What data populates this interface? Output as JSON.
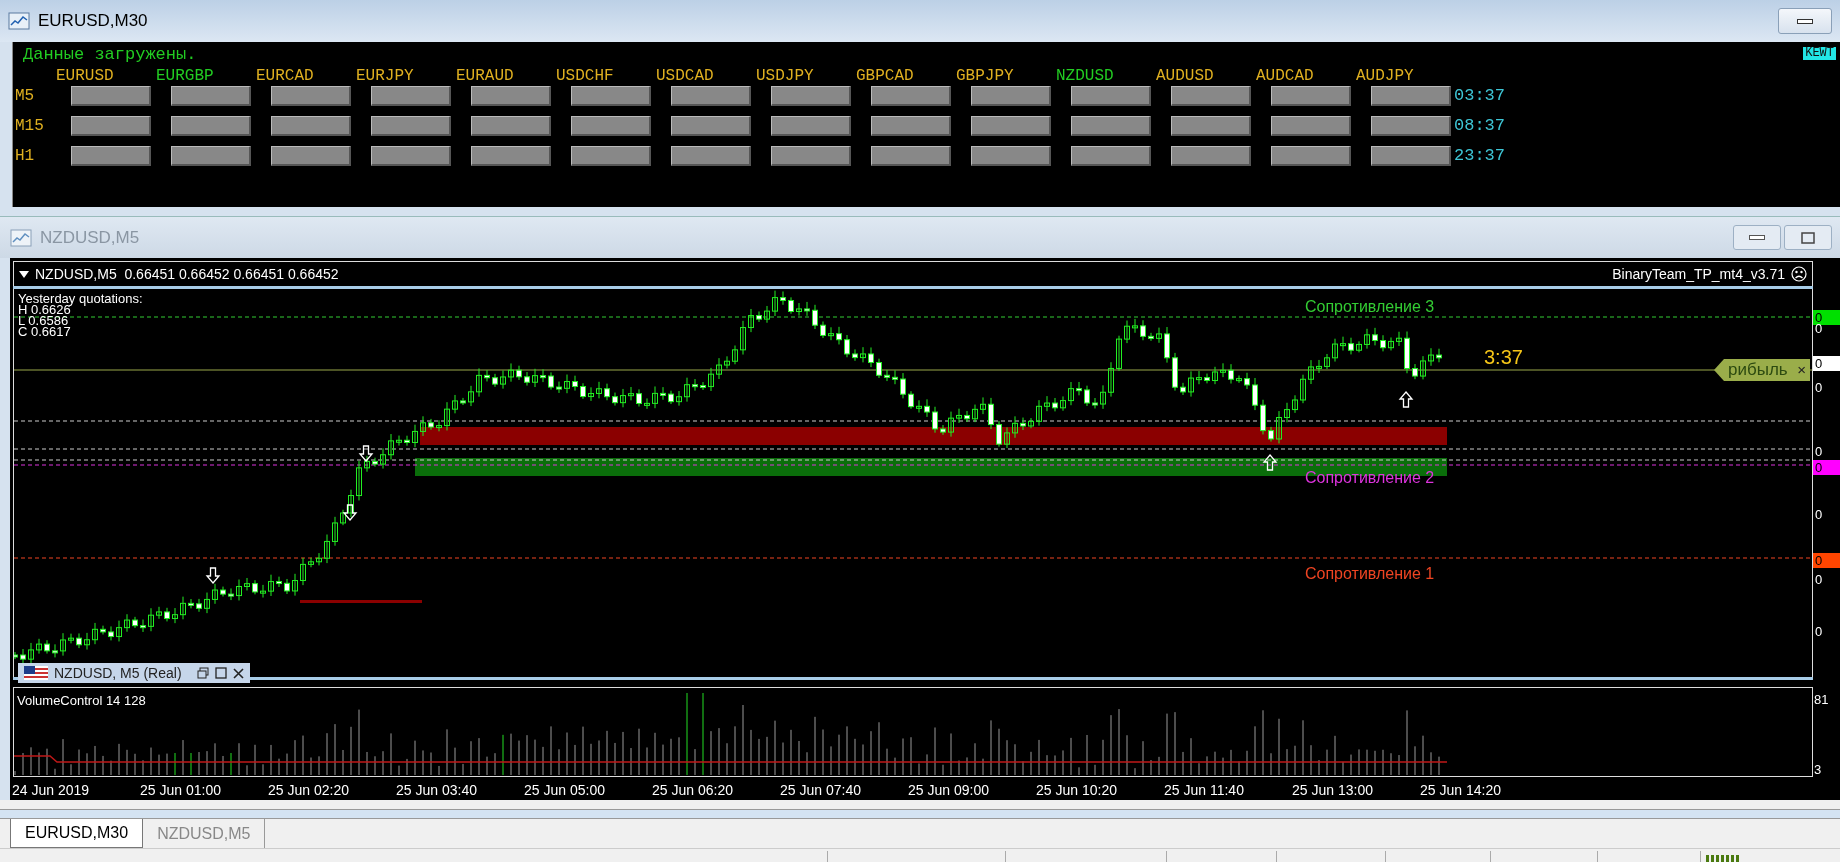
{
  "top_window": {
    "title": "EURUSD,M30"
  },
  "scanner": {
    "status": "Данные загружены.",
    "badge": "KEWT",
    "pairs": [
      {
        "name": "EURUSD",
        "color": "#e0b020"
      },
      {
        "name": "EURGBP",
        "color": "#22cc22"
      },
      {
        "name": "EURCAD",
        "color": "#e0b020"
      },
      {
        "name": "EURJPY",
        "color": "#e0b020"
      },
      {
        "name": "EURAUD",
        "color": "#e0b020"
      },
      {
        "name": "USDCHF",
        "color": "#e0b020"
      },
      {
        "name": "USDCAD",
        "color": "#e0b020"
      },
      {
        "name": "USDJPY",
        "color": "#e0b020"
      },
      {
        "name": "GBPCAD",
        "color": "#e0b020"
      },
      {
        "name": "GBPJPY",
        "color": "#e0b020"
      },
      {
        "name": "NZDUSD",
        "color": "#22cc22"
      },
      {
        "name": "AUDUSD",
        "color": "#e0b020"
      },
      {
        "name": "AUDCAD",
        "color": "#e0b020"
      },
      {
        "name": "AUDJPY",
        "color": "#e0b020"
      }
    ],
    "rows": [
      {
        "label": "M5",
        "timer": "03:37"
      },
      {
        "label": "M15",
        "timer": "08:37"
      },
      {
        "label": "H1",
        "timer": "23:37"
      }
    ]
  },
  "chart_window": {
    "title": "NZDUSD,M5",
    "header": "NZDUSD,M5  0.66451 0.66452 0.66451 0.66452",
    "indicator": "BinaryTeam_TP_mt4_v3.71",
    "yesterday": [
      "Yesterday quotations:",
      "H 0.6626",
      "L 0.6586",
      "C 0.6617"
    ],
    "levels": [
      {
        "label": "Сопротивление 3",
        "color": "#33cc33"
      },
      {
        "label": "Сопротивление 2",
        "color": "#dd33dd"
      },
      {
        "label": "Сопротивление 1",
        "color": "#ee4422"
      }
    ],
    "timer": "3:37",
    "profit_tag": {
      "text": "рибыль",
      "close": "×"
    },
    "price_axis": [
      {
        "text": "0",
        "kind": "tag",
        "color": "#00e000"
      },
      {
        "text": "0",
        "kind": "plain"
      },
      {
        "text": "0",
        "kind": "tag",
        "color": "#ffffff"
      },
      {
        "text": "0",
        "kind": "plain"
      },
      {
        "text": "0",
        "kind": "plain"
      },
      {
        "text": "0",
        "kind": "tag",
        "color": "#ff00ff"
      },
      {
        "text": "0",
        "kind": "plain"
      },
      {
        "text": "0",
        "kind": "tag",
        "color": "#ff4500"
      },
      {
        "text": "0",
        "kind": "plain"
      },
      {
        "text": "0",
        "kind": "plain"
      }
    ],
    "mini_tab": "NZDUSD, M5 (Real)",
    "volume_label": "VolumeControl 14 128",
    "volume_axis": [
      "81",
      "3"
    ],
    "time_axis": [
      "24 Jun 2019",
      "25 Jun 01:00",
      "25 Jun 02:20",
      "25 Jun 03:40",
      "25 Jun 05:00",
      "25 Jun 06:20",
      "25 Jun 07:40",
      "25 Jun 09:00",
      "25 Jun 10:20",
      "25 Jun 11:40",
      "25 Jun 13:00",
      "25 Jun 14:20"
    ]
  },
  "tabs": [
    {
      "label": "EURUSD,M30",
      "selected": true
    },
    {
      "label": "NZDUSD,M5",
      "selected": false
    }
  ]
}
